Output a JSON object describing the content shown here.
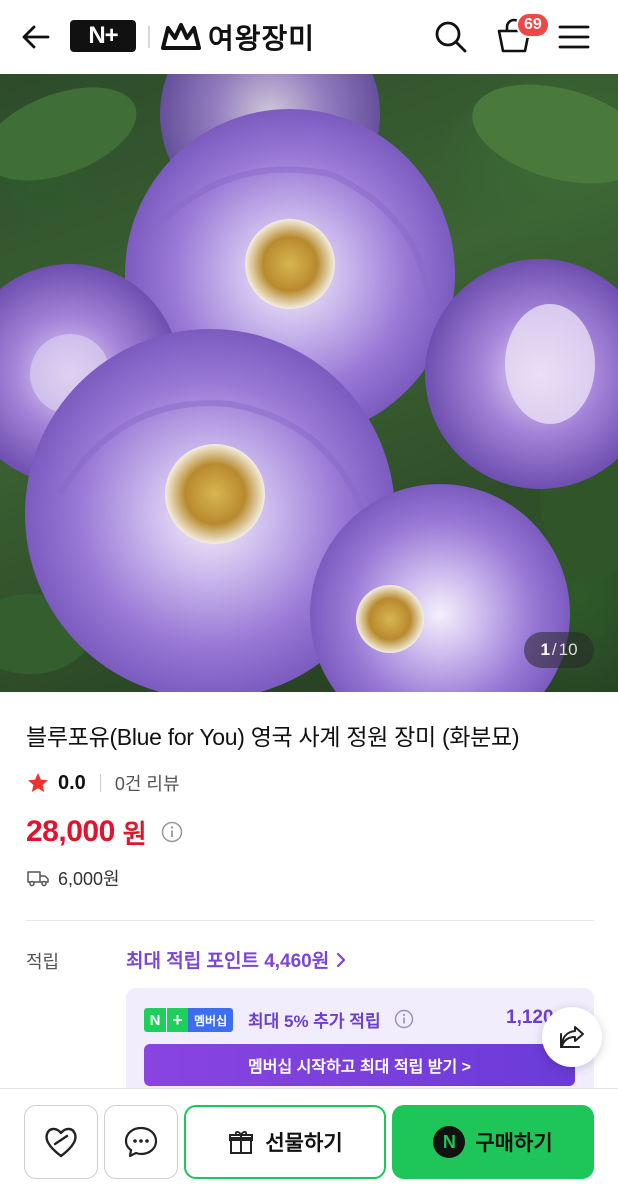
{
  "header": {
    "logo_text": "N+",
    "store_name": "여왕장미",
    "cart_count": "69",
    "icons": [
      "back-arrow-icon",
      "search-icon",
      "cart-icon",
      "menu-icon"
    ]
  },
  "gallery": {
    "current": "1",
    "separator": "/",
    "total": "10"
  },
  "product": {
    "title": "블루포유(Blue for You) 영국 사계 정원 장미 (화분묘)",
    "rating": "0.0",
    "review_count": "0건 리뷰",
    "price": "28,000",
    "price_unit": "원",
    "shipping_fee": "6,000원"
  },
  "points": {
    "label": "적립",
    "max_points": "최대 적립 포인트 4,460원",
    "membership_badge": "멤버십",
    "membership_rate": "최대 5% 추가 적립",
    "membership_amount": "1,120",
    "membership_cta": "멤버십 시작하고 최대 적립 받기 >"
  },
  "bottom_bar": {
    "gift_label": "선물하기",
    "buy_label": "구매하기",
    "pay_badge": "N"
  },
  "colors": {
    "price_red": "#e0142c",
    "accent_purple": "#7a46d6",
    "naver_green": "#1ec65a",
    "badge_red": "#f04646"
  }
}
